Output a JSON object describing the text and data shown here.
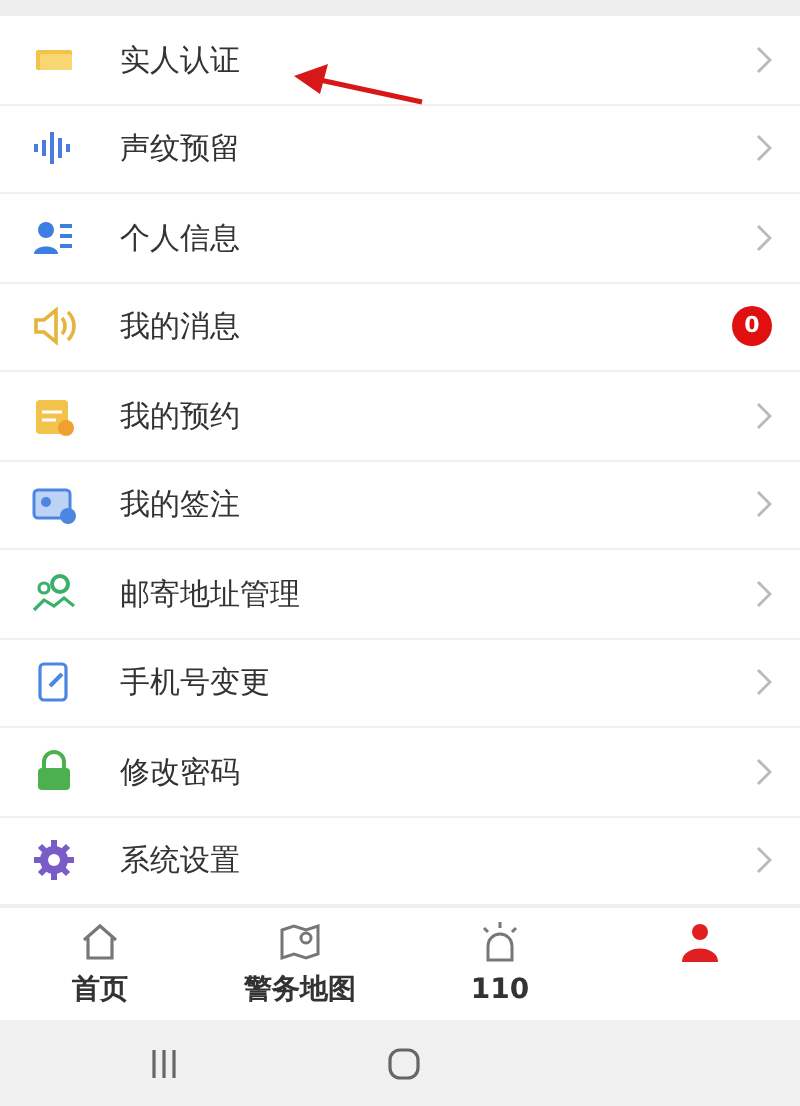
{
  "menu": [
    {
      "label": "实人认证"
    },
    {
      "label": "声纹预留"
    },
    {
      "label": "个人信息"
    },
    {
      "label": "我的消息",
      "badge": "0"
    },
    {
      "label": "我的预约"
    },
    {
      "label": "我的签注"
    },
    {
      "label": "邮寄地址管理"
    },
    {
      "label": "手机号变更"
    },
    {
      "label": "修改密码"
    },
    {
      "label": "系统设置"
    }
  ],
  "tabs": [
    {
      "label": "首页",
      "selected": false
    },
    {
      "label": "警务地图",
      "selected": false
    },
    {
      "label": "110",
      "selected": false
    },
    {
      "selected": true
    }
  ]
}
